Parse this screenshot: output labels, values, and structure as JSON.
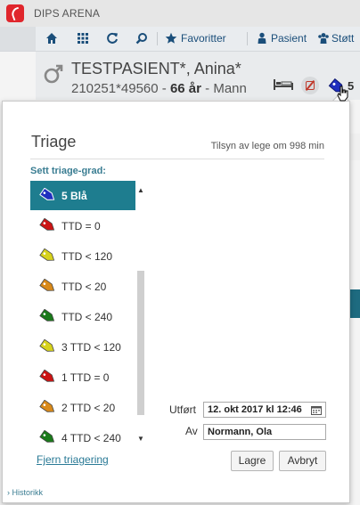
{
  "app": {
    "title": "DIPS ARENA"
  },
  "toolbar": {
    "favorites": "Favoritter",
    "patient": "Pasient",
    "support": "Støtt"
  },
  "patient": {
    "name": "TESTPASIENT*, Anina*",
    "id": "210251*49560",
    "separator": "-",
    "age": "66 år",
    "gender": "Mann",
    "tag_count": "5"
  },
  "triage": {
    "title": "Triage",
    "supervision": "Tilsyn av lege om 998 min",
    "set_label": "Sett triage-grad:",
    "items": [
      {
        "label": "5 Blå",
        "color": "#1f2fbf",
        "selected": true
      },
      {
        "label": "TTD = 0",
        "color": "#cc1414"
      },
      {
        "label": "TTD < 120",
        "color": "#d7d21c"
      },
      {
        "label": "TTD < 20",
        "color": "#d98a1a"
      },
      {
        "label": "TTD < 240",
        "color": "#1b7a1b"
      },
      {
        "label": "3 TTD < 120",
        "color": "#d7d21c"
      },
      {
        "label": "1 TTD = 0",
        "color": "#cc1414"
      },
      {
        "label": "2 TTD < 20",
        "color": "#d98a1a"
      },
      {
        "label": "4 TTD < 240",
        "color": "#1b7a1b"
      }
    ],
    "remove_link": "Fjern triagering",
    "history": "Historikk",
    "performed_label": "Utført",
    "performed_value": "12. okt 2017 kl 12:46",
    "by_label": "Av",
    "by_value": "Normann, Ola",
    "save_button": "Lagre",
    "cancel_button": "Avbryt"
  },
  "colors": {
    "accent": "#1e7d8f",
    "link": "#2a7a96",
    "brand": "#e0262c"
  }
}
